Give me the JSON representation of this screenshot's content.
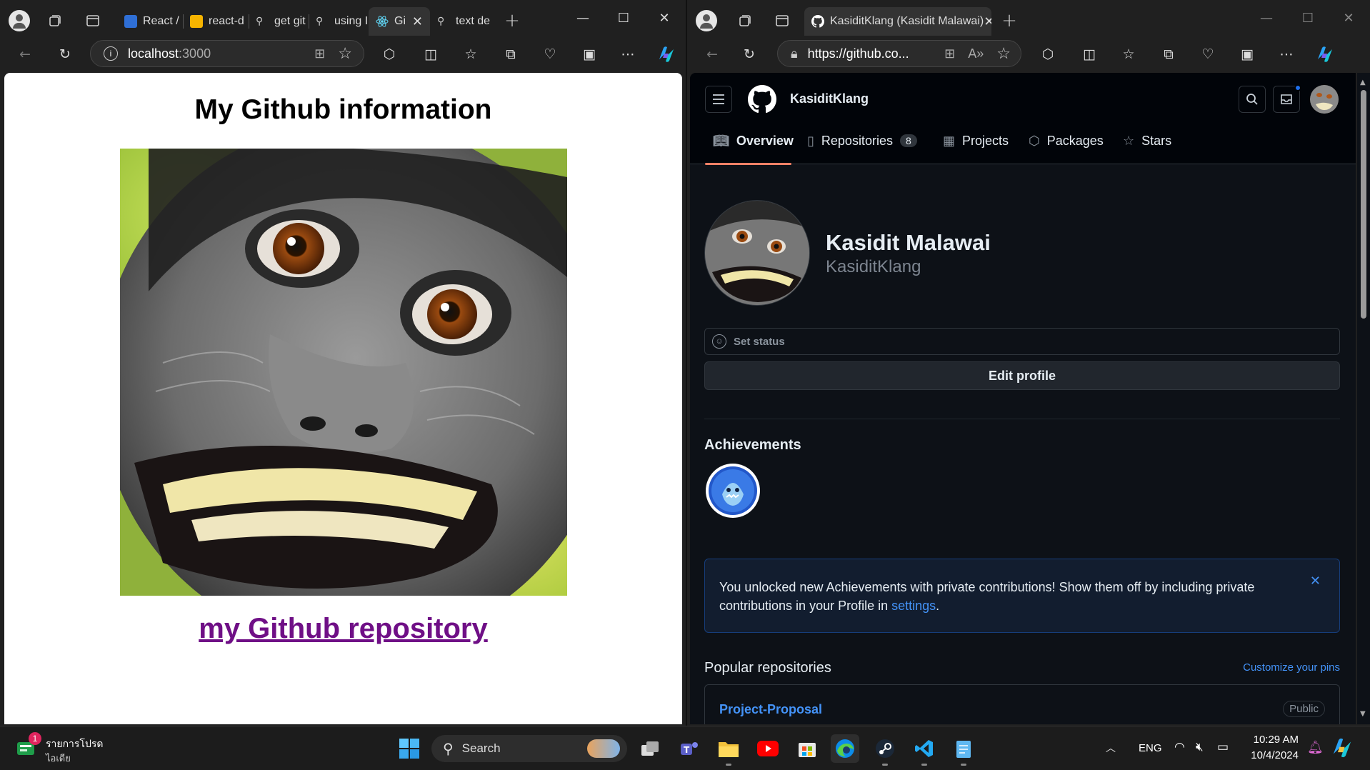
{
  "left_browser": {
    "tabs": [
      {
        "label": "React /",
        "icon": "react-docs-icon",
        "color": "#2f6fd6"
      },
      {
        "label": "react-d",
        "icon": "slides-icon",
        "color": "#f6b400"
      },
      {
        "label": "get git",
        "icon": "search-icon"
      },
      {
        "label": "using I",
        "icon": "search-icon"
      },
      {
        "label": "Gi",
        "icon": "react-atom-icon",
        "active": true
      },
      {
        "label": "text de",
        "icon": "search-icon"
      }
    ],
    "url": "localhost:3000",
    "url_host": "localhost",
    "url_port": ":3000"
  },
  "left_page": {
    "heading": "My Github information",
    "link_text": "my Github repository"
  },
  "right_browser": {
    "tab_title": "KasiditKlang (Kasidit Malawai)",
    "url": "https://github.co..."
  },
  "github": {
    "context_name": "KasiditKlang",
    "nav": {
      "overview": "Overview",
      "repositories": "Repositories",
      "repositories_count": "8",
      "projects": "Projects",
      "packages": "Packages",
      "stars": "Stars"
    },
    "profile": {
      "name": "Kasidit Malawai",
      "username": "KasiditKlang",
      "set_status": "Set status",
      "edit_profile": "Edit profile"
    },
    "achievements_title": "Achievements",
    "banner": {
      "text": "You unlocked new Achievements with private contributions! Show them off by including private contributions in your Profile in ",
      "link": "settings",
      "end": "."
    },
    "popular": {
      "title": "Popular repositories",
      "customize": "Customize your pins",
      "repo_name": "Project-Proposal",
      "visibility": "Public"
    },
    "colors": {
      "accent_link": "#4493f8",
      "underline": "#f78166",
      "bg": "#0d1117"
    }
  },
  "taskbar": {
    "notification_count": "1",
    "widget_line1": "รายการโปรด",
    "widget_line2": "ไอเดีย",
    "search_label": "Search",
    "lang": "ENG",
    "time": "10:29 AM",
    "date": "10/4/2024"
  }
}
